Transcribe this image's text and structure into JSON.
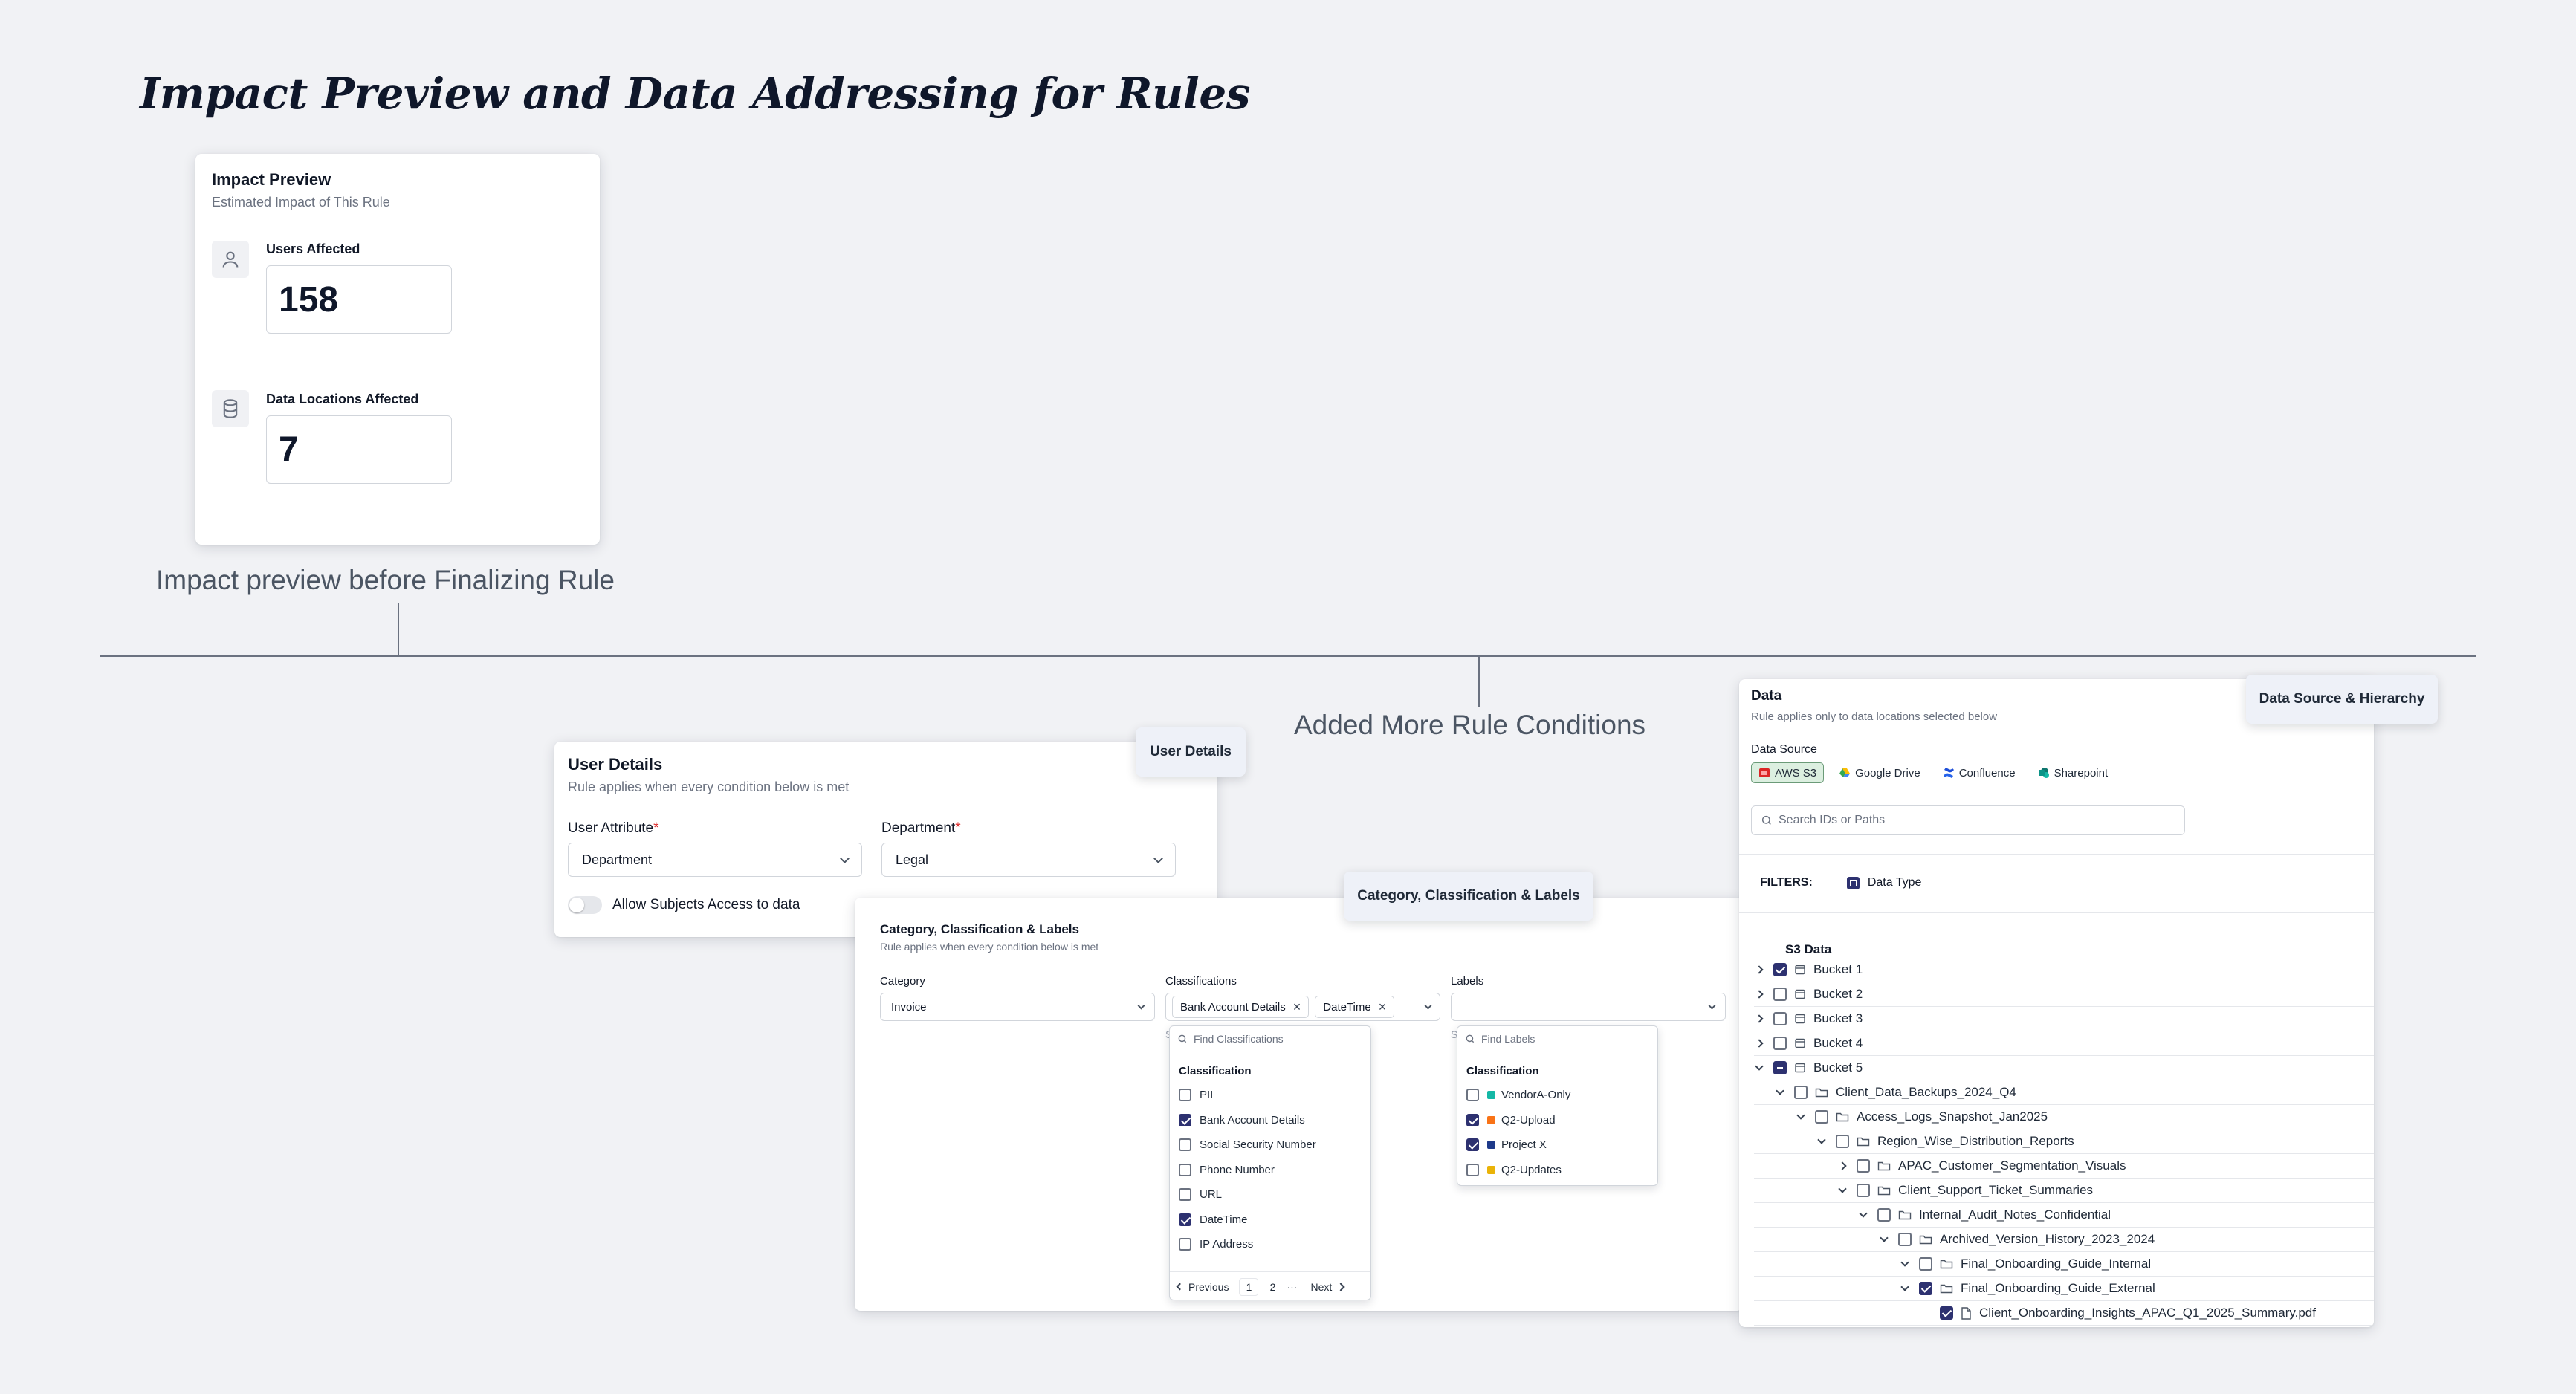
{
  "page_title": "Impact Preview and Data Addressing for Rules",
  "impact_card": {
    "title": "Impact Preview",
    "subtitle": "Estimated Impact of This Rule",
    "users_label": "Users Affected",
    "users_value": "158",
    "locations_label": "Data Locations Affected",
    "locations_value": "7"
  },
  "caption_impact": "Impact preview before Finalizing Rule",
  "caption_conditions": "Added More Rule Conditions",
  "tags": {
    "user_details": "User Details",
    "category": "Category, Classification & Labels",
    "data_source": "Data Source & Hierarchy"
  },
  "user_details": {
    "title": "User Details",
    "subtitle": "Rule applies when every condition below is met",
    "attr_label": "User Attribute",
    "attr_value": "Department",
    "dept_label": "Department",
    "dept_value": "Legal",
    "toggle_label": "Allow Subjects Access to data"
  },
  "category_card": {
    "title": "Category, Classification & Labels",
    "subtitle": "Rule applies when every condition below is met",
    "category_label": "Category",
    "category_value": "Invoice",
    "classifications_label": "Classifications",
    "classification_chips": [
      "Bank Account Details",
      "DateTime"
    ],
    "labels_label": "Labels",
    "class_search_placeholder": "Find Classifications",
    "class_group": "Classification",
    "class_options": [
      {
        "label": "PII",
        "checked": false
      },
      {
        "label": "Bank Account Details",
        "checked": true
      },
      {
        "label": "Social Security Number",
        "checked": false
      },
      {
        "label": "Phone Number",
        "checked": false
      },
      {
        "label": "URL",
        "checked": false
      },
      {
        "label": "DateTime",
        "checked": true
      },
      {
        "label": "IP Address",
        "checked": false
      }
    ],
    "pagination": {
      "prev": "Previous",
      "pages": [
        "1",
        "2"
      ],
      "ellipsis": "···",
      "next": "Next"
    },
    "labels_search_placeholder": "Find Labels",
    "labels_group": "Classification",
    "label_options": [
      {
        "label": "VendorA-Only",
        "checked": false,
        "color": "#14b8a6"
      },
      {
        "label": "Q2-Upload",
        "checked": true,
        "color": "#f97316"
      },
      {
        "label": "Project X",
        "checked": true,
        "color": "#1e3a8a"
      },
      {
        "label": "Q2-Updates",
        "checked": false,
        "color": "#eab308"
      }
    ]
  },
  "data_card": {
    "title": "Data",
    "subtitle": "Rule applies only to data locations selected below",
    "source_label": "Data Source",
    "sources": [
      {
        "label": "AWS S3",
        "active": true,
        "icon": "aws-s3-icon"
      },
      {
        "label": "Google Drive",
        "active": false,
        "icon": "google-drive-icon"
      },
      {
        "label": "Confluence",
        "active": false,
        "icon": "confluence-icon"
      },
      {
        "label": "Sharepoint",
        "active": false,
        "icon": "sharepoint-icon"
      }
    ],
    "search_placeholder": "Search IDs or Paths",
    "filters_label": "FILTERS:",
    "filter_chip": "Data Type",
    "tree_header": "S3 Data",
    "tree": [
      {
        "label": "Bucket 1",
        "level": 0,
        "toggle": "collapsed",
        "check": "checked",
        "icon": "bucket"
      },
      {
        "label": "Bucket 2",
        "level": 0,
        "toggle": "collapsed",
        "check": "unchecked",
        "icon": "bucket"
      },
      {
        "label": "Bucket 3",
        "level": 0,
        "toggle": "collapsed",
        "check": "unchecked",
        "icon": "bucket"
      },
      {
        "label": "Bucket 4",
        "level": 0,
        "toggle": "collapsed",
        "check": "unchecked",
        "icon": "bucket"
      },
      {
        "label": "Bucket 5",
        "level": 0,
        "toggle": "expanded",
        "check": "partial",
        "icon": "bucket"
      },
      {
        "label": "Client_Data_Backups_2024_Q4",
        "level": 1,
        "toggle": "expanded",
        "check": "unchecked",
        "icon": "folder"
      },
      {
        "label": "Access_Logs_Snapshot_Jan2025",
        "level": 2,
        "toggle": "expanded",
        "check": "unchecked",
        "icon": "folder"
      },
      {
        "label": "Region_Wise_Distribution_Reports",
        "level": 3,
        "toggle": "expanded",
        "check": "unchecked",
        "icon": "folder"
      },
      {
        "label": "APAC_Customer_Segmentation_Visuals",
        "level": 4,
        "toggle": "collapsed",
        "check": "unchecked",
        "icon": "folder"
      },
      {
        "label": "Client_Support_Ticket_Summaries",
        "level": 4,
        "toggle": "expanded",
        "check": "unchecked",
        "icon": "folder"
      },
      {
        "label": "Internal_Audit_Notes_Confidential",
        "level": 5,
        "toggle": "expanded",
        "check": "unchecked",
        "icon": "folder"
      },
      {
        "label": "Archived_Version_History_2023_2024",
        "level": 6,
        "toggle": "expanded",
        "check": "unchecked",
        "icon": "folder"
      },
      {
        "label": "Final_Onboarding_Guide_Internal",
        "level": 7,
        "toggle": "expanded",
        "check": "unchecked",
        "icon": "folder"
      },
      {
        "label": "Final_Onboarding_Guide_External",
        "level": 7,
        "toggle": "expanded",
        "check": "checked",
        "icon": "folder"
      },
      {
        "label": "Client_Onboarding_Insights_APAC_Q1_2025_Summary.pdf",
        "level": 8,
        "toggle": "none",
        "check": "checked",
        "icon": "file"
      }
    ]
  }
}
